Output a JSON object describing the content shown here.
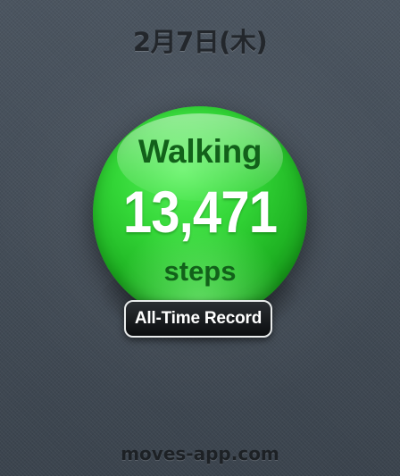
{
  "header": {
    "date": "2月7日(木)"
  },
  "summary": {
    "activity": "Walking",
    "steps": "13,471",
    "unit": "steps"
  },
  "record_badge": {
    "label": "All-Time Record"
  },
  "footer": {
    "watermark": "moves-app.com"
  },
  "colors": {
    "ball_green": "#33d637",
    "label_dark_green": "#12611a",
    "background": "#46505b",
    "badge_background": "#0b0d0f"
  }
}
